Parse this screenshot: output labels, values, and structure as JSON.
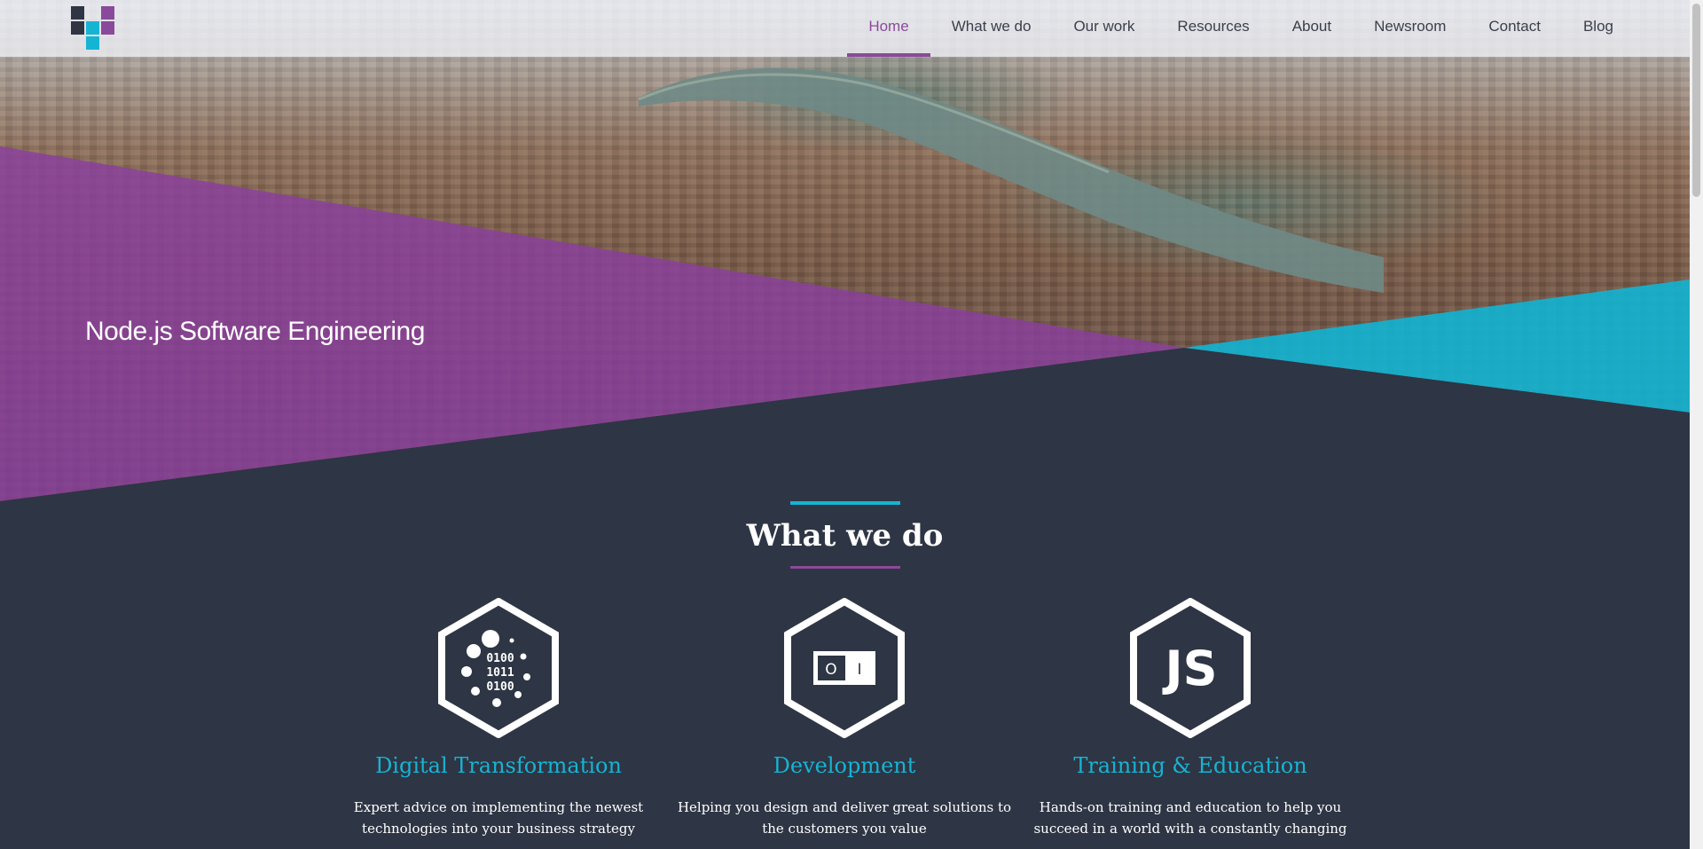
{
  "nav": {
    "items": [
      {
        "label": "Home",
        "active": true
      },
      {
        "label": "What we do",
        "active": false
      },
      {
        "label": "Our work",
        "active": false
      },
      {
        "label": "Resources",
        "active": false
      },
      {
        "label": "About",
        "active": false
      },
      {
        "label": "Newsroom",
        "active": false
      },
      {
        "label": "Contact",
        "active": false
      },
      {
        "label": "Blog",
        "active": false
      }
    ],
    "logo_icon": "company-logo"
  },
  "hero": {
    "title": "Node.js Software Engineering",
    "background": "aerial-city-river-photo"
  },
  "section": {
    "title": "What we do",
    "services": [
      {
        "icon": "binary-data-icon",
        "icon_text": [
          "0100",
          "1011",
          "0100"
        ],
        "title": "Digital Transformation",
        "description": "Expert advice on implementing the newest technologies into your business strategy"
      },
      {
        "icon": "toggle-switch-icon",
        "icon_text": [
          "O",
          "I"
        ],
        "title": "Development",
        "description": "Helping you design and deliver great solutions to the customers you value"
      },
      {
        "icon": "javascript-icon",
        "icon_text": [
          "JS"
        ],
        "title": "Training & Education",
        "description": "Hands-on training and education to help you succeed in a world with a constantly changing"
      }
    ]
  },
  "colors": {
    "purple": "#8a4a9b",
    "cyan": "#16b4d3",
    "dark": "#2e3544",
    "nav_text": "#3a3f4b"
  }
}
